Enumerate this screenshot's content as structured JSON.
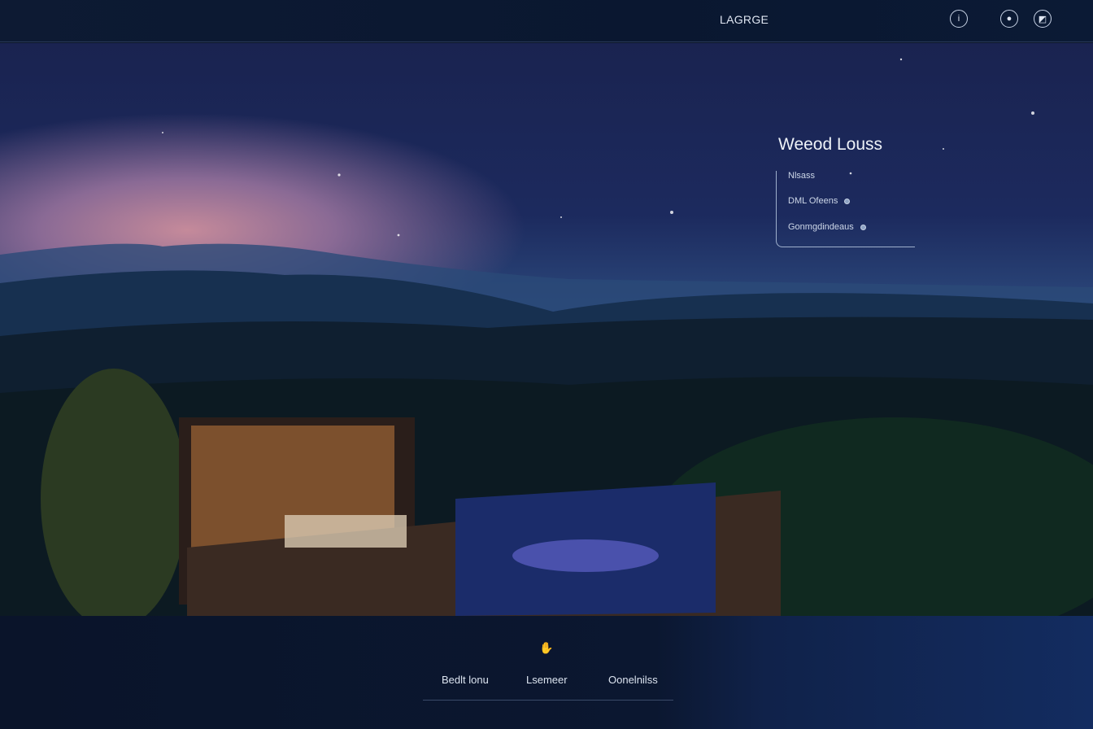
{
  "header": {
    "brand": "LAGRGE",
    "icons": [
      "info-icon",
      "user-icon",
      "share-icon"
    ]
  },
  "panel": {
    "title": "Weeod Louss",
    "items": [
      "Nlsass",
      "DML Ofeens",
      "Gonmgdindeaus"
    ]
  },
  "footer": {
    "icon": "hand-icon",
    "nav": [
      "Bedlt lonu",
      "Lsemeer",
      "Oonelnilss"
    ]
  },
  "colors": {
    "background": "#0a1428",
    "accent": "#c8d3e6"
  }
}
